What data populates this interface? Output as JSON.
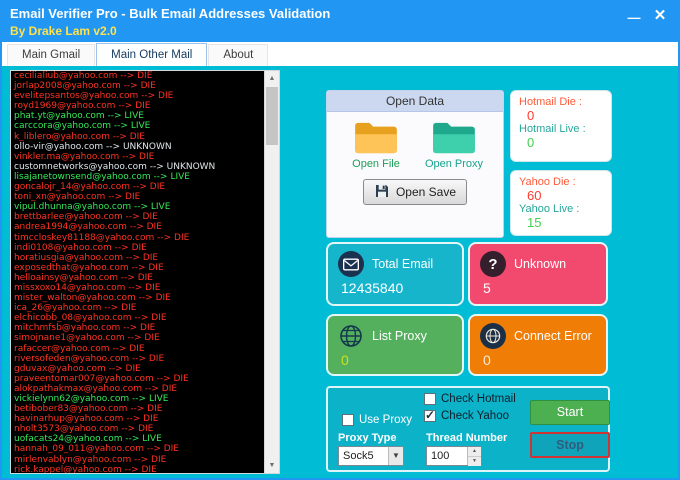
{
  "window": {
    "title": "Email Verifier Pro - Bulk Email Addresses Validation",
    "subtitle": "By Drake Lam v2.0",
    "minimize_icon": "—",
    "close_icon": "✕"
  },
  "tabs": [
    {
      "label": "Main Gmail",
      "active": false
    },
    {
      "label": "Main Other Mail",
      "active": true
    },
    {
      "label": "About",
      "active": false
    }
  ],
  "list_config": {
    "separator": "--&gt;"
  },
  "email_list": [
    {
      "email": "cecilialiub@yahoo.com",
      "status": "DIE"
    },
    {
      "email": "jorlap2008@yahoo.com",
      "status": "DIE"
    },
    {
      "email": "evelitepsantos@yahoo.com",
      "status": "DIE"
    },
    {
      "email": "royd1969@yahoo.com",
      "status": "DIE"
    },
    {
      "email": "phat.yt@yahoo.com",
      "status": "LIVE"
    },
    {
      "email": "carccora@yahoo.com",
      "status": "LIVE"
    },
    {
      "email": "k_liblero@yahoo.com",
      "status": "DIE"
    },
    {
      "email": "ollo-vir@yahoo.com",
      "status": "UNKNOWN"
    },
    {
      "email": "vinkler.ma@yahoo.com",
      "status": "DIE"
    },
    {
      "email": "customnetworks@yahoo.com",
      "status": "UNKNOWN"
    },
    {
      "email": "lisajanetownsend@yahoo.com",
      "status": "LIVE"
    },
    {
      "email": "goncalojr_14@yahoo.com",
      "status": "DIE"
    },
    {
      "email": "toni_xn@yahoo.com",
      "status": "DIE"
    },
    {
      "email": "vipul.dhunna@yahoo.com",
      "status": "LIVE"
    },
    {
      "email": "brettbarlee@yahoo.com",
      "status": "DIE"
    },
    {
      "email": "andrea1994@yahoo.com",
      "status": "DIE"
    },
    {
      "email": "timccloskey81188@yahoo.com",
      "status": "DIE"
    },
    {
      "email": "indi0108@yahoo.com",
      "status": "DIE"
    },
    {
      "email": "horatiusgia@yahoo.com",
      "status": "DIE"
    },
    {
      "email": "exposedthat@yahoo.com",
      "status": "DIE"
    },
    {
      "email": "helloainsy@yahoo.com",
      "status": "DIE"
    },
    {
      "email": "missxoxo14@yahoo.com",
      "status": "DIE"
    },
    {
      "email": "mister_walton@yahoo.com",
      "status": "DIE"
    },
    {
      "email": "ica_26@yahoo.com",
      "status": "DIE"
    },
    {
      "email": "elchicobb_08@yahoo.com",
      "status": "DIE"
    },
    {
      "email": "mitchmfsb@yahoo.com",
      "status": "DIE"
    },
    {
      "email": "simojnane1@yahoo.com",
      "status": "DIE"
    },
    {
      "email": "rafaccer@yahoo.com",
      "status": "DIE"
    },
    {
      "email": "riversofeden@yahoo.com",
      "status": "DIE"
    },
    {
      "email": "gduvax@yahoo.com",
      "status": "DIE"
    },
    {
      "email": "praveentomar007@yahoo.com",
      "status": "DIE"
    },
    {
      "email": "alokpathakmax@yahoo.com",
      "status": "DIE"
    },
    {
      "email": "vickielynn62@yahoo.com",
      "status": "LIVE"
    },
    {
      "email": "betibober83@yahoo.com",
      "status": "DIE"
    },
    {
      "email": "havinarhup@yahoo.com",
      "status": "DIE"
    },
    {
      "email": "nholt3573@yahoo.com",
      "status": "DIE"
    },
    {
      "email": "uofacats24@yahoo.com",
      "status": "LIVE"
    },
    {
      "email": "hannah_09_011@yahoo.com",
      "status": "DIE"
    },
    {
      "email": "mirlenvablyn@yahoo.com",
      "status": "DIE"
    },
    {
      "email": "rick.kappel@yahoo.com",
      "status": "DIE"
    }
  ],
  "open_data": {
    "title": "Open Data",
    "open_file_label": "Open File",
    "open_proxy_label": "Open Proxy",
    "open_save_label": "Open Save"
  },
  "stats": {
    "hotmail_die_label": "Hotmail Die :",
    "hotmail_die_value": "0",
    "hotmail_live_label": "Hotmail Live :",
    "hotmail_live_value": "0",
    "yahoo_die_label": "Yahoo Die :",
    "yahoo_die_value": "60",
    "yahoo_live_label": "Yahoo Live :",
    "yahoo_live_value": "15"
  },
  "cards": {
    "total_email_label": "Total Email",
    "total_email_value": "12435840",
    "unknown_label": "Unknown",
    "unknown_value": "5",
    "unknown_icon": "?",
    "list_proxy_label": "List Proxy",
    "list_proxy_value": "0",
    "connect_error_label": "Connect Error",
    "connect_error_value": "0"
  },
  "controls": {
    "use_proxy": {
      "label": "Use Proxy",
      "checked": false
    },
    "check_hotmail": {
      "label": "Check Hotmail",
      "checked": false
    },
    "check_yahoo": {
      "label": "Check Yahoo",
      "checked": true
    },
    "proxy_type_label": "Proxy Type",
    "proxy_type_value": "Sock5",
    "thread_number_label": "Thread Number",
    "thread_number_value": "100",
    "start_label": "Start",
    "stop_label": "Stop"
  },
  "colors": {
    "titlebar": "#2196f3",
    "content_bg": "#00bcd4",
    "status_die": "#ff3222",
    "status_live": "#35e957",
    "status_unknown": "#dfe6ea",
    "card_total_email": "#17b5cb",
    "card_unknown": "#f24a6e",
    "card_list_proxy": "#55b05e",
    "card_connect_error": "#f07d05",
    "start_button": "#4caf50"
  }
}
